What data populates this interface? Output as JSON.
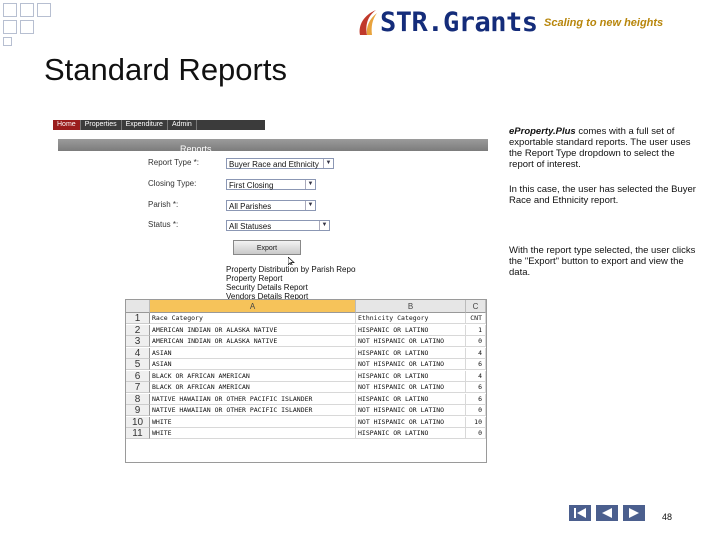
{
  "header": {
    "logo_text": "STR.Grants",
    "tagline": "Scaling to new heights"
  },
  "slide": {
    "title": "Standard Reports",
    "page_number": "48"
  },
  "app": {
    "tabs": [
      "Home",
      "Properties",
      "Expenditure",
      "Admin"
    ],
    "reports_bar_label": "Reports",
    "fields": [
      {
        "label": "Report Type *:",
        "value": "Buyer Race and Ethnicity"
      },
      {
        "label": "Closing Type:",
        "value": "First Closing"
      },
      {
        "label": "Parish *:",
        "value": "All Parishes"
      },
      {
        "label": "Status *:",
        "value": "All Statuses"
      }
    ],
    "export_label": "Export",
    "dropdown_items": [
      "Property Distribution by Parish Report",
      "Property Report",
      "Security Details Report",
      "Vendors Details Report"
    ]
  },
  "spreadsheet": {
    "columns": [
      "A",
      "B",
      "C"
    ],
    "rows": [
      {
        "n": "1",
        "a": "Race Category",
        "b": "Ethnicity Category",
        "c": "CNT"
      },
      {
        "n": "2",
        "a": "AMERICAN INDIAN OR ALASKA NATIVE",
        "b": "HISPANIC OR LATINO",
        "c": "1"
      },
      {
        "n": "3",
        "a": "AMERICAN INDIAN OR ALASKA NATIVE",
        "b": "NOT HISPANIC OR LATINO",
        "c": "0"
      },
      {
        "n": "4",
        "a": "ASIAN",
        "b": "HISPANIC OR LATINO",
        "c": "4"
      },
      {
        "n": "5",
        "a": "ASIAN",
        "b": "NOT HISPANIC OR LATINO",
        "c": "6"
      },
      {
        "n": "6",
        "a": "BLACK OR AFRICAN AMERICAN",
        "b": "HISPANIC OR LATINO",
        "c": "4"
      },
      {
        "n": "7",
        "a": "BLACK OR AFRICAN AMERICAN",
        "b": "NOT HISPANIC OR LATINO",
        "c": "6"
      },
      {
        "n": "8",
        "a": "NATIVE HAWAIIAN OR OTHER PACIFIC ISLANDER",
        "b": "HISPANIC OR LATINO",
        "c": "6"
      },
      {
        "n": "9",
        "a": "NATIVE HAWAIIAN OR OTHER PACIFIC ISLANDER",
        "b": "NOT HISPANIC OR LATINO",
        "c": "0"
      },
      {
        "n": "10",
        "a": "WHITE",
        "b": "NOT HISPANIC OR LATINO",
        "c": "10"
      },
      {
        "n": "11",
        "a": "WHITE",
        "b": "HISPANIC OR LATINO",
        "c": "0"
      }
    ]
  },
  "description": {
    "p1_emph": "eProperty.Plus",
    "p1_rest": " comes with a full set of exportable standard reports. The user uses the Report Type dropdown to select the report of interest.",
    "p2": "In this case, the user has selected the Buyer Race and Ethnicity report.",
    "p3": "With the report type selected, the user clicks the \"Export\" button to export and view the data."
  },
  "colors": {
    "logo_blue": "#142c7a",
    "tagline_gold": "#b8860b",
    "nav_blue": "#4b5f8e",
    "column_a_highlight": "#f6c35a"
  }
}
